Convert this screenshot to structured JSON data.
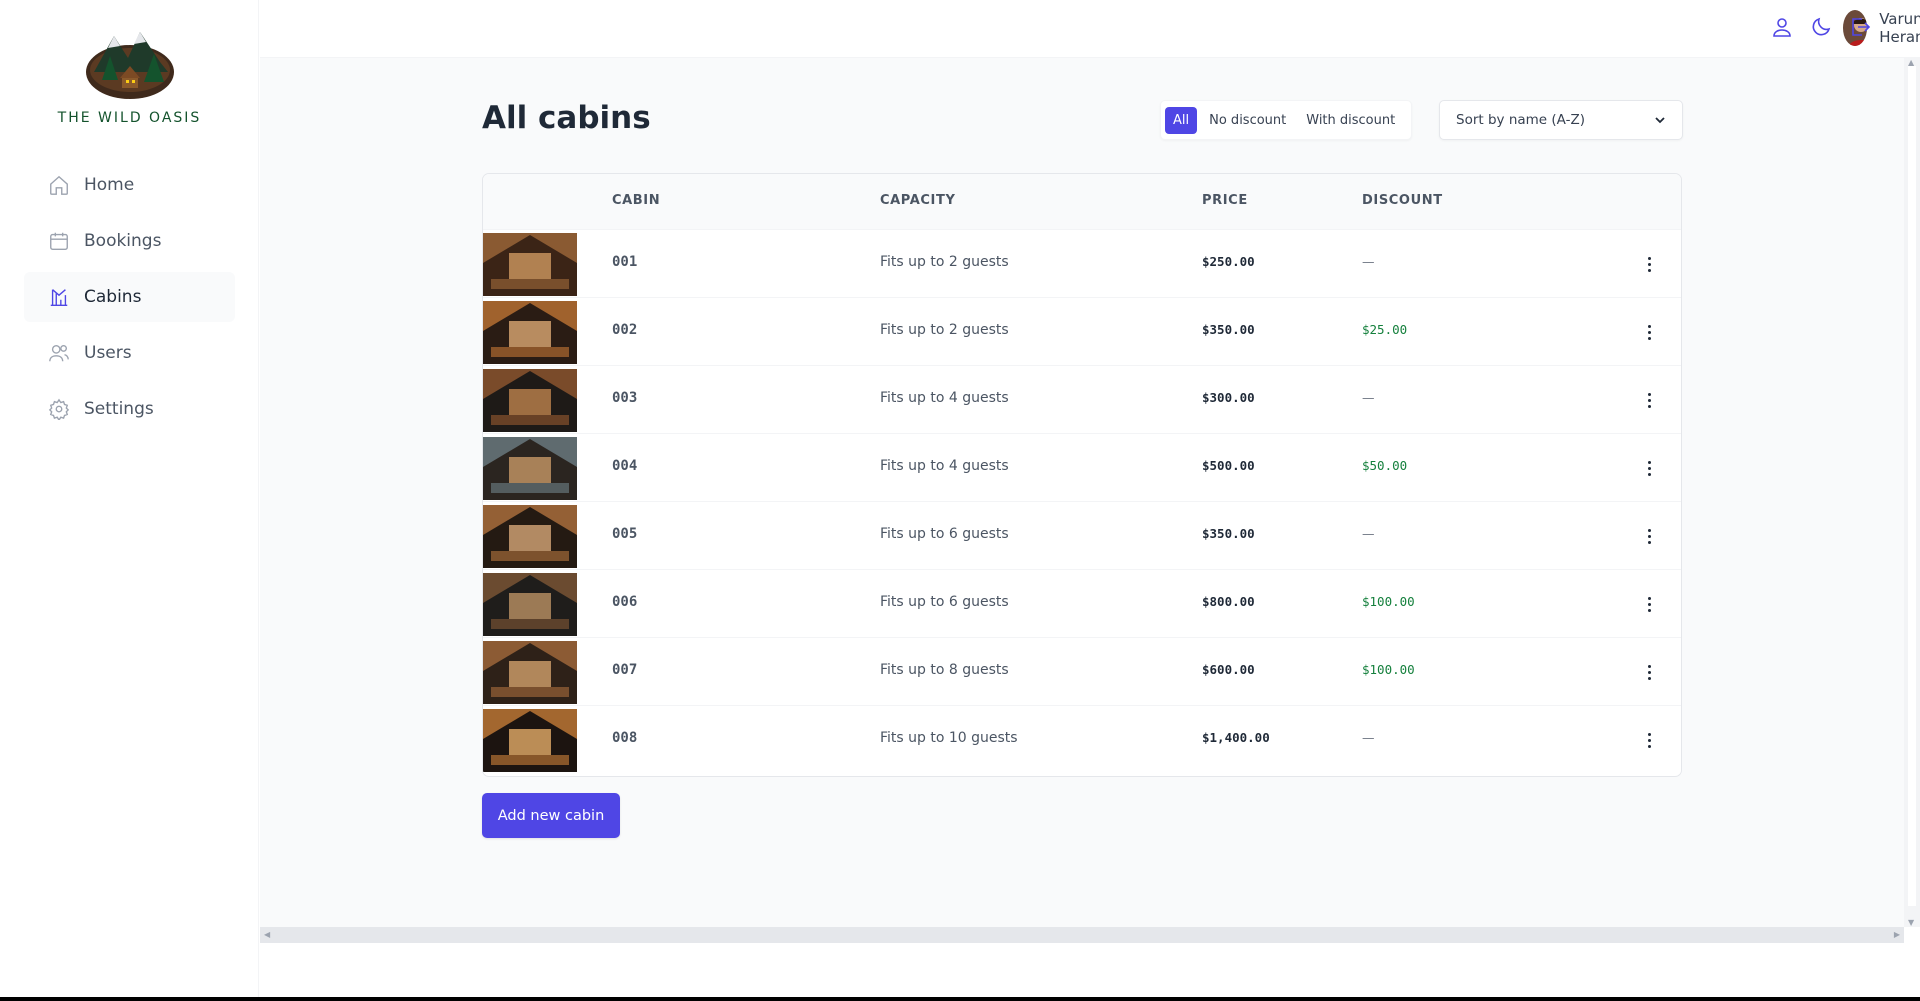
{
  "app": {
    "brand": "THE WILD OASIS"
  },
  "sidebar": {
    "items": [
      {
        "label": "Home",
        "icon": "home-icon",
        "active": false
      },
      {
        "label": "Bookings",
        "icon": "calendar-icon",
        "active": false
      },
      {
        "label": "Cabins",
        "icon": "cabins-icon",
        "active": true
      },
      {
        "label": "Users",
        "icon": "users-icon",
        "active": false
      },
      {
        "label": "Settings",
        "icon": "gear-icon",
        "active": false
      }
    ]
  },
  "header": {
    "user_name": "Varun Heranjal",
    "icons": [
      "user-icon",
      "moon-icon",
      "logout-icon"
    ]
  },
  "page": {
    "title": "All cabins",
    "filters": [
      "All",
      "No discount",
      "With discount"
    ],
    "active_filter": "All",
    "sort_value": "Sort by name (A-Z)",
    "add_button": "Add new cabin"
  },
  "table": {
    "headers": [
      "",
      "CABIN",
      "CAPACITY",
      "PRICE",
      "DISCOUNT"
    ],
    "rows": [
      {
        "name": "001",
        "capacity": "Fits up to 2 guests",
        "price": "$250.00",
        "discount": "—"
      },
      {
        "name": "002",
        "capacity": "Fits up to 2 guests",
        "price": "$350.00",
        "discount": "$25.00"
      },
      {
        "name": "003",
        "capacity": "Fits up to 4 guests",
        "price": "$300.00",
        "discount": "—"
      },
      {
        "name": "004",
        "capacity": "Fits up to 4 guests",
        "price": "$500.00",
        "discount": "$50.00"
      },
      {
        "name": "005",
        "capacity": "Fits up to 6 guests",
        "price": "$350.00",
        "discount": "—"
      },
      {
        "name": "006",
        "capacity": "Fits up to 6 guests",
        "price": "$800.00",
        "discount": "$100.00"
      },
      {
        "name": "007",
        "capacity": "Fits up to 8 guests",
        "price": "$600.00",
        "discount": "$100.00"
      },
      {
        "name": "008",
        "capacity": "Fits up to 10 guests",
        "price": "$1,400.00",
        "discount": "—"
      }
    ]
  },
  "colors": {
    "brand": "#4f46e5",
    "discount": "#15803d"
  }
}
